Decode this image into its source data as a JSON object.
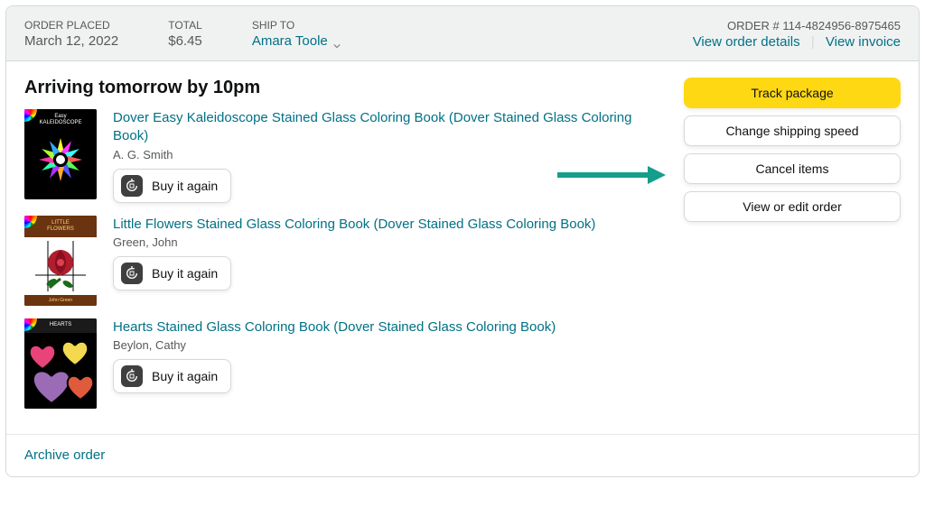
{
  "header": {
    "order_placed_label": "ORDER PLACED",
    "order_placed_value": "March 12, 2022",
    "total_label": "TOTAL",
    "total_value": "$6.45",
    "ship_to_label": "SHIP TO",
    "ship_to_value": "Amara Toole",
    "order_number_label": "ORDER #",
    "order_number_value": "114-4824956-8975465",
    "view_order_details": "View order details",
    "view_invoice": "View invoice"
  },
  "arriving_heading": "Arriving tomorrow by 10pm",
  "items": [
    {
      "title": "Dover Easy Kaleidoscope Stained Glass Coloring Book (Dover Stained Glass Coloring Book)",
      "author": "A. G. Smith",
      "thumb_title_line1": "Easy",
      "thumb_title_line2": "KALEIDOSCOPE"
    },
    {
      "title": "Little Flowers Stained Glass Coloring Book (Dover Stained Glass Coloring Book)",
      "author": "Green, John",
      "thumb_title_line1": "LITTLE",
      "thumb_title_line2": "FLOWERS",
      "thumb_author": "John Green"
    },
    {
      "title": "Hearts Stained Glass Coloring Book (Dover Stained Glass Coloring Book)",
      "author": "Beylon, Cathy",
      "thumb_title_line1": "HEARTS"
    }
  ],
  "buy_again_label": "Buy it again",
  "actions": {
    "track_package": "Track package",
    "change_shipping": "Change shipping speed",
    "cancel_items": "Cancel items",
    "view_edit_order": "View or edit order"
  },
  "archive_label": "Archive order"
}
